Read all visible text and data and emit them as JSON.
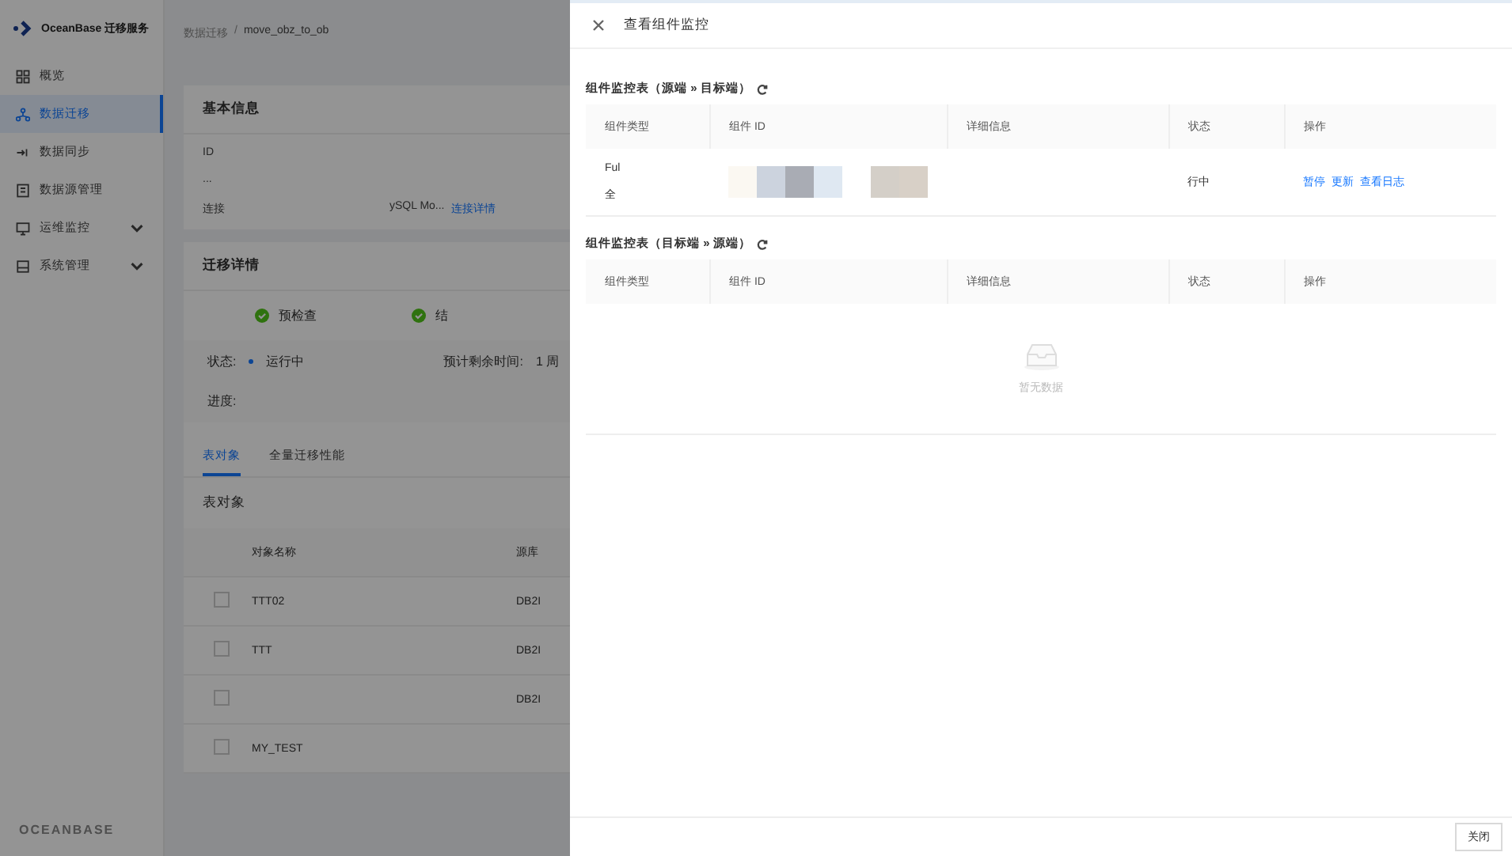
{
  "sidebar": {
    "logo": "OceanBase 迁移服务",
    "items": [
      {
        "label": "概览",
        "selected": false,
        "expandable": false
      },
      {
        "label": "数据迁移",
        "selected": true,
        "expandable": false
      },
      {
        "label": "数据同步",
        "selected": false,
        "expandable": false
      },
      {
        "label": "数据源管理",
        "selected": false,
        "expandable": false
      },
      {
        "label": "运维监控",
        "selected": false,
        "expandable": true
      },
      {
        "label": "系统管理",
        "selected": false,
        "expandable": true
      }
    ],
    "footer": "OCEANBASE"
  },
  "breadcrumb": [
    "数据迁移",
    "/",
    "move_obz_to_ob"
  ],
  "basic_info": {
    "title": "基本信息",
    "rows": [
      {
        "label": "ID"
      },
      {
        "label": "..."
      },
      {
        "label": "连接",
        "value": "ySQL Mo...",
        "link": "连接详情"
      }
    ]
  },
  "migration": {
    "title": "迁移详情",
    "steps": [
      {
        "label": "预检查",
        "done": true
      },
      {
        "label": "结",
        "done": true
      }
    ],
    "status_label": "状态:",
    "status": "运行中",
    "time_label": "预计剩余时间:",
    "time": "1 周",
    "progress_label": "进度:",
    "tabs": [
      {
        "label": "表对象",
        "selected": true
      },
      {
        "label": "全量迁移性能",
        "selected": false
      }
    ],
    "table_title": "表对象",
    "columns": [
      "对象名称",
      "源库"
    ],
    "rows": [
      {
        "name": "TTT02",
        "source": "DB2I",
        "checked": false
      },
      {
        "name": "TTT",
        "source": "DB2I",
        "checked": false
      },
      {
        "name": "",
        "source": "DB2I",
        "checked": false
      },
      {
        "name": "MY_TEST",
        "source": "",
        "checked": false
      }
    ]
  },
  "drawer": {
    "title": "查看组件监控",
    "sections": [
      {
        "title": "组件监控表（源端 » 目标端）",
        "columns": [
          "组件类型",
          "组件 ID",
          "详细信息",
          "状态",
          "操作"
        ],
        "rows": [
          {
            "type": "Ful",
            "type2": "全",
            "status": "行中",
            "actions": [
              "暂停",
              "更新",
              "查看日志"
            ]
          }
        ]
      },
      {
        "title": "组件监控表（目标端 » 源端）",
        "columns": [
          "组件类型",
          "组件 ID",
          "详细信息",
          "状态",
          "操作"
        ],
        "empty": "暂无数据"
      }
    ],
    "close_button": "关闭"
  }
}
